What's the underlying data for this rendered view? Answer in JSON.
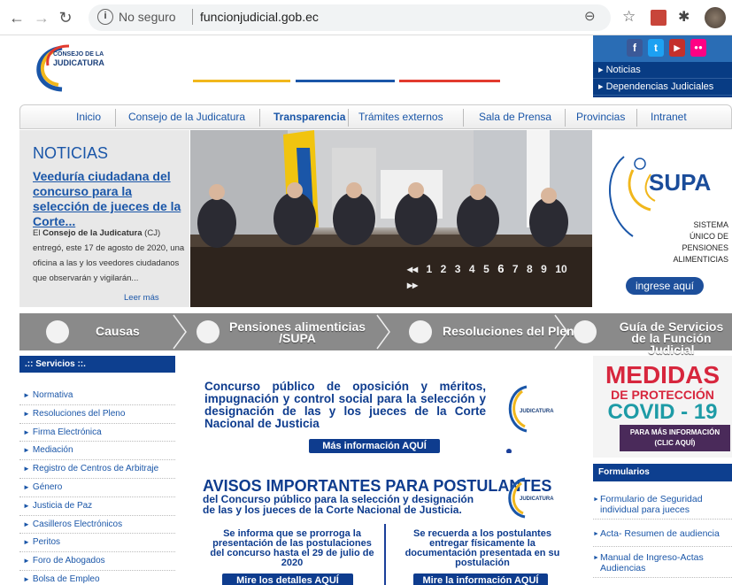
{
  "browser": {
    "security_label": "No seguro",
    "url": "funcionjudicial.gob.ec"
  },
  "header": {
    "logo_line1": "CONSEJO DE LA",
    "logo_line2": "JUDICATURA",
    "quick_links": [
      "Noticias",
      "Dependencias Judiciales"
    ],
    "social": [
      "f",
      "t",
      "▶",
      "●●"
    ]
  },
  "nav": [
    "Inicio",
    "Consejo de la Judicatura",
    "Transparencia",
    "Trámites externos",
    "Sala de Prensa",
    "Provincias",
    "Intranet"
  ],
  "news": {
    "heading": "NOTICIAS",
    "title": "Veeduría ciudadana del concurso para la selección de jueces de la Corte...",
    "body_prefix": "El ",
    "body_bold": "Consejo de la Judicatura",
    "body_rest": " (CJ) entregó, este 17 de agosto de 2020, una oficina a las y los veedores ciudadanos que observarán y vigilarán...",
    "more": "Leer más"
  },
  "slider": {
    "prev": "◂◂",
    "pages": [
      "1",
      "2",
      "3",
      "4",
      "5",
      "6",
      "7",
      "8",
      "9",
      "10"
    ],
    "active": "6",
    "next": "▸▸"
  },
  "supa": {
    "title": "SUPA",
    "line1": "SISTEMA",
    "line2": "ÚNICO DE",
    "line3": "PENSIONES",
    "line4": "ALIMENTICIAS",
    "button": "ingrese aquí"
  },
  "services_bar": {
    "causas": "Causas",
    "pensiones1": "Pensiones alimenticias",
    "pensiones2": "/SUPA",
    "resoluciones": "Resoluciones del Pleno",
    "guia1": "Guía de Servicios",
    "guia2": "de la Función Judicial"
  },
  "services": {
    "header": ".:: Servicios ::.",
    "items": [
      "Normativa",
      "Resoluciones del Pleno",
      "Firma Electrónica",
      "Mediación",
      "Registro de Centros de Arbitraje",
      "Género",
      "Justicia de Paz",
      "Casilleros Electrónicos",
      "Peritos",
      "Foro de Abogados",
      "Bolsa de Empleo"
    ]
  },
  "center": {
    "concurso": "Concurso público de oposición y méritos, impugnación y control social para la selección y designación de las y los jueces de la Corte Nacional de Justicia",
    "mas_info": "Más información AQUÍ",
    "avisos": "AVISOS IMPORTANTES PARA POSTULANTES",
    "avisos_sub": "del Concurso público para la selección y designación de las y los jueces de la Corte Nacional de Justicia.",
    "col1": "Se informa que se prorroga la presentación de las postulaciones del concurso hasta el 29 de julio de 2020",
    "col1_btn": "Mire los detalles AQUÍ",
    "col2": "Se recuerda a los postulantes entregar físicamente la documentación presentada en su postulación",
    "col2_btn": "Mire la información AQUÍ"
  },
  "covid": {
    "line1": "MEDIDAS",
    "line2": "DE PROTECCIÓN",
    "line3": "COVID - 19",
    "btn1": "PARA MÁS INFORMACIÓN",
    "btn2": "(CLIC AQUÍ)"
  },
  "forms": {
    "header": "Formularios",
    "items": [
      "Formulario de Seguridad individual para jueces",
      "Acta- Resumen de audiencia",
      "Manual de Ingreso-Actas Audiencias"
    ]
  }
}
